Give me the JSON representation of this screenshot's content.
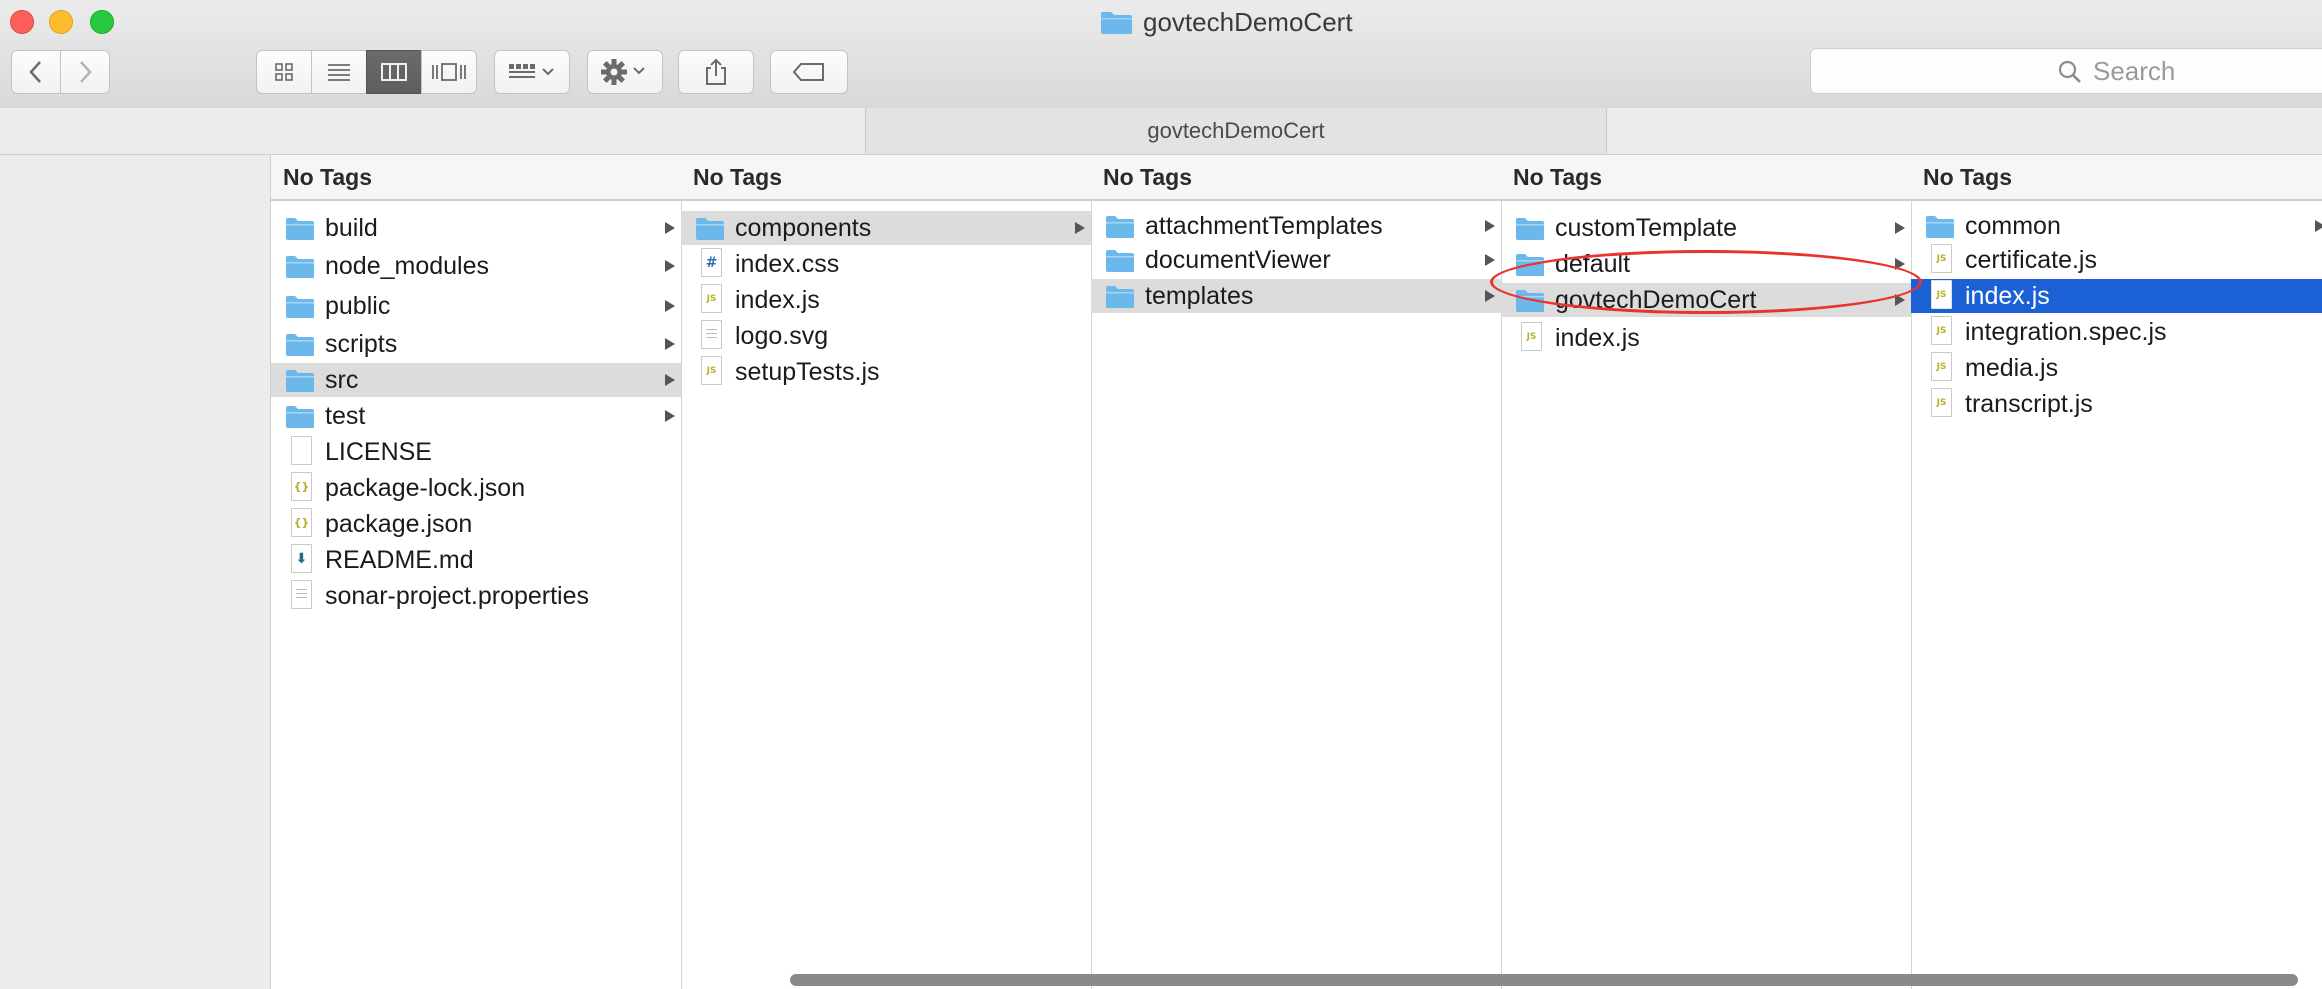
{
  "window": {
    "title": "govtechDemoCert"
  },
  "toolbar": {
    "back_icon": "chevron-left-icon",
    "forward_icon": "chevron-right-icon",
    "view_modes": [
      "icon-view",
      "list-view",
      "column-view",
      "gallery-view"
    ],
    "active_view": "column-view",
    "group_icon": "group-by-icon",
    "action_icon": "gear-icon",
    "share_icon": "share-icon",
    "tags_icon": "tag-icon"
  },
  "search": {
    "placeholder": "Search"
  },
  "pathbar": {
    "label": "govtechDemoCert"
  },
  "colors": {
    "folder": "#6cb8ea",
    "selection_active": "#1b60d4",
    "selection_inactive": "#dcdcdc",
    "annotation": "#e8342a"
  },
  "columns": [
    {
      "header": "No Tags",
      "items": [
        {
          "name": "build",
          "kind": "folder"
        },
        {
          "name": "node_modules",
          "kind": "folder"
        },
        {
          "name": "public",
          "kind": "folder"
        },
        {
          "name": "scripts",
          "kind": "folder"
        },
        {
          "name": "src",
          "kind": "folder",
          "selected": "gray"
        },
        {
          "name": "test",
          "kind": "folder"
        },
        {
          "name": "LICENSE",
          "kind": "file"
        },
        {
          "name": "package-lock.json",
          "kind": "json"
        },
        {
          "name": "package.json",
          "kind": "json"
        },
        {
          "name": "README.md",
          "kind": "md"
        },
        {
          "name": "sonar-project.properties",
          "kind": "text"
        }
      ]
    },
    {
      "header": "No Tags",
      "items": [
        {
          "name": "components",
          "kind": "folder",
          "selected": "gray"
        },
        {
          "name": "index.css",
          "kind": "css"
        },
        {
          "name": "index.js",
          "kind": "js"
        },
        {
          "name": "logo.svg",
          "kind": "text"
        },
        {
          "name": "setupTests.js",
          "kind": "js"
        }
      ]
    },
    {
      "header": "No Tags",
      "items": [
        {
          "name": "attachmentTemplates",
          "kind": "folder"
        },
        {
          "name": "documentViewer",
          "kind": "folder"
        },
        {
          "name": "templates",
          "kind": "folder",
          "selected": "gray"
        }
      ]
    },
    {
      "header": "No Tags",
      "items": [
        {
          "name": "customTemplate",
          "kind": "folder"
        },
        {
          "name": "default",
          "kind": "folder"
        },
        {
          "name": "govtechDemoCert",
          "kind": "folder",
          "selected": "gray"
        },
        {
          "name": "index.js",
          "kind": "js"
        }
      ]
    },
    {
      "header": "No Tags",
      "items": [
        {
          "name": "common",
          "kind": "folder"
        },
        {
          "name": "certificate.js",
          "kind": "js"
        },
        {
          "name": "index.js",
          "kind": "js",
          "selected": "blue"
        },
        {
          "name": "integration.spec.js",
          "kind": "js"
        },
        {
          "name": "media.js",
          "kind": "js"
        },
        {
          "name": "transcript.js",
          "kind": "js"
        }
      ]
    }
  ]
}
